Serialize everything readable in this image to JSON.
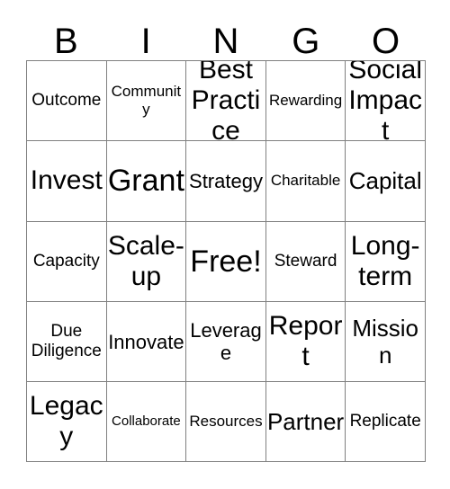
{
  "card": {
    "header_letters": [
      "B",
      "I",
      "N",
      "G",
      "O"
    ],
    "colors": {
      "border": "#808080",
      "text": "#000000",
      "background": "#ffffff"
    },
    "rows": [
      [
        {
          "label": "Outcome",
          "size": "md"
        },
        {
          "label": "Community",
          "size": "sm"
        },
        {
          "label": "Best Practice",
          "size": "2xl"
        },
        {
          "label": "Rewarding",
          "size": "sm"
        },
        {
          "label": "Social Impact",
          "size": "2xl"
        }
      ],
      [
        {
          "label": "Invest",
          "size": "2xl"
        },
        {
          "label": "Grant",
          "size": "3xl"
        },
        {
          "label": "Strategy",
          "size": "lg"
        },
        {
          "label": "Charitable",
          "size": "sm"
        },
        {
          "label": "Capital",
          "size": "xl"
        }
      ],
      [
        {
          "label": "Capacity",
          "size": "md"
        },
        {
          "label": "Scale-up",
          "size": "2xl"
        },
        {
          "label": "Free!",
          "size": "3xl"
        },
        {
          "label": "Steward",
          "size": "md"
        },
        {
          "label": "Long-term",
          "size": "2xl"
        }
      ],
      [
        {
          "label": "Due Diligence",
          "size": "md"
        },
        {
          "label": "Innovate",
          "size": "lg"
        },
        {
          "label": "Leverage",
          "size": "lg"
        },
        {
          "label": "Report",
          "size": "2xl"
        },
        {
          "label": "Mission",
          "size": "xl"
        }
      ],
      [
        {
          "label": "Legacy",
          "size": "2xl"
        },
        {
          "label": "Collaborate",
          "size": "xs"
        },
        {
          "label": "Resources",
          "size": "sm"
        },
        {
          "label": "Partner",
          "size": "xl"
        },
        {
          "label": "Replicate",
          "size": "md"
        }
      ]
    ]
  }
}
